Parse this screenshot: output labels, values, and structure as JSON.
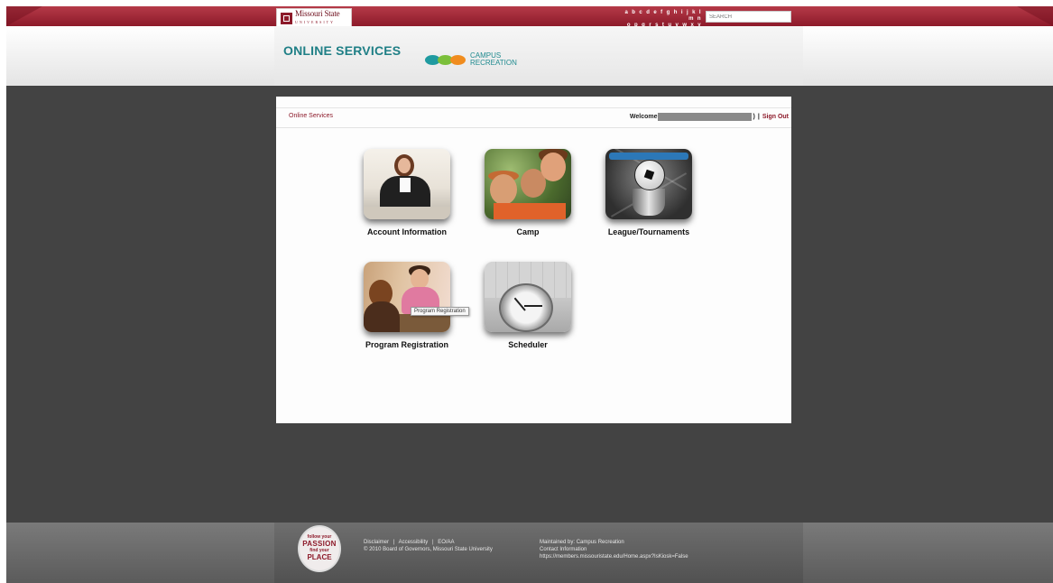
{
  "topbar": {
    "logo_main": "Missouri State",
    "logo_sub": "UNIVERSITY",
    "az_line1": "a b c d e f g h i j k l m n",
    "az_line2": "o p q r s t u v w x y z",
    "search_placeholder": "SEARCH"
  },
  "header": {
    "title": "ONLINE SERVICES",
    "brand_line1": "CAMPUS",
    "brand_line2": "RECREATION",
    "brand_colors": [
      "#1f9aa0",
      "#7bbf3a",
      "#f08c1e"
    ]
  },
  "panel": {
    "breadcrumb": "Online Services",
    "welcome": "Welcome",
    "welcome_suffix": ")",
    "sign_out_sep": "|",
    "sign_out": "Sign Out",
    "tiles": [
      {
        "label": "Account Information",
        "icon": "account-photo"
      },
      {
        "label": "Camp",
        "icon": "camp-photo"
      },
      {
        "label": "League/Tournaments",
        "icon": "league-photo"
      },
      {
        "label": "Program Registration",
        "icon": "program-photo"
      },
      {
        "label": "Scheduler",
        "icon": "scheduler-photo"
      }
    ],
    "tooltip": "Program Registration"
  },
  "footer": {
    "badge_l1": "follow your",
    "badge_l2": "PASSION",
    "badge_l3": "find your",
    "badge_l4": "PLACE",
    "links": [
      "Disclaimer",
      "Accessibility",
      "EO/AA"
    ],
    "link_sep": "|",
    "copyright": "© 2010 Board of Governors, Missouri State University",
    "maintained": "Maintained by: Campus Recreation",
    "contact": "Contact Information",
    "url": "https://members.missouristate.edu/Home.aspx?IsKiosk=False"
  },
  "colors": {
    "maroon": "#8d1a2a",
    "teal": "#1f7f86",
    "dark_bg": "#434343"
  }
}
